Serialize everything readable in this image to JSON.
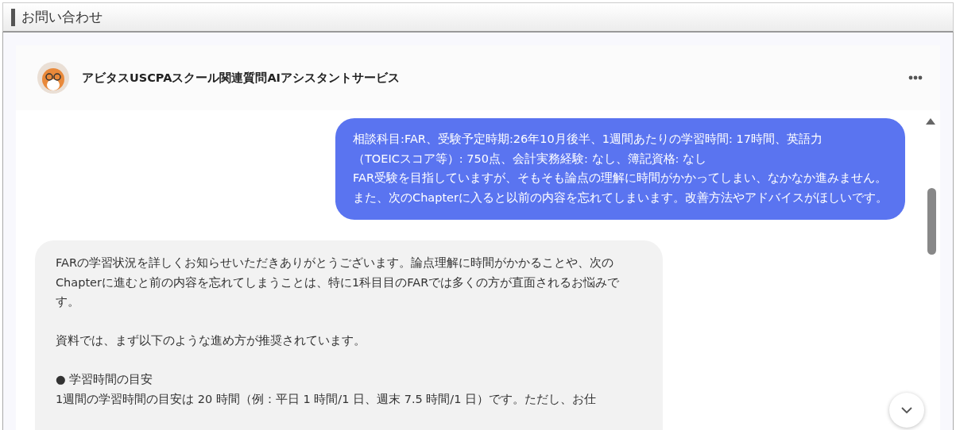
{
  "page_header": {
    "title": "お問い合わせ"
  },
  "chat": {
    "title": "アビタスUSCPAスクール関連質問AIアシスタントサービス",
    "messages": [
      {
        "kind": "user",
        "paragraphs": [
          [
            "相談科目:FAR、受験予定時期:26年10月後半、1週間あたりの学習時間: 17時間、英語力",
            "（TOEICスコア等）: 750点、会計実務経験: なし、簿記資格: なし",
            "FAR受験を目指していますが、そもそも論点の理解に時間がかかってしまい、なかなか進みません。",
            "また、次のChapterに入ると以前の内容を忘れてしまいます。改善方法やアドバイスがほしいです。"
          ]
        ]
      },
      {
        "kind": "assistant",
        "paragraphs": [
          [
            "FARの学習状況を詳しくお知らせいただきありがとうございます。論点理解に時間がかかることや、次の",
            "Chapterに進むと前の内容を忘れてしまうことは、特に1科目目のFARでは多くの方が直面されるお悩みで",
            "す。"
          ],
          [
            "資料では、まず以下のような進め方が推奨されています。"
          ],
          [
            "● 学習時間の目安",
            "1週間の学習時間の目安は 20 時間（例：平日 1 時間/1 日、週末 7.5 時間/1 日）です。ただし、お仕"
          ]
        ]
      }
    ]
  }
}
